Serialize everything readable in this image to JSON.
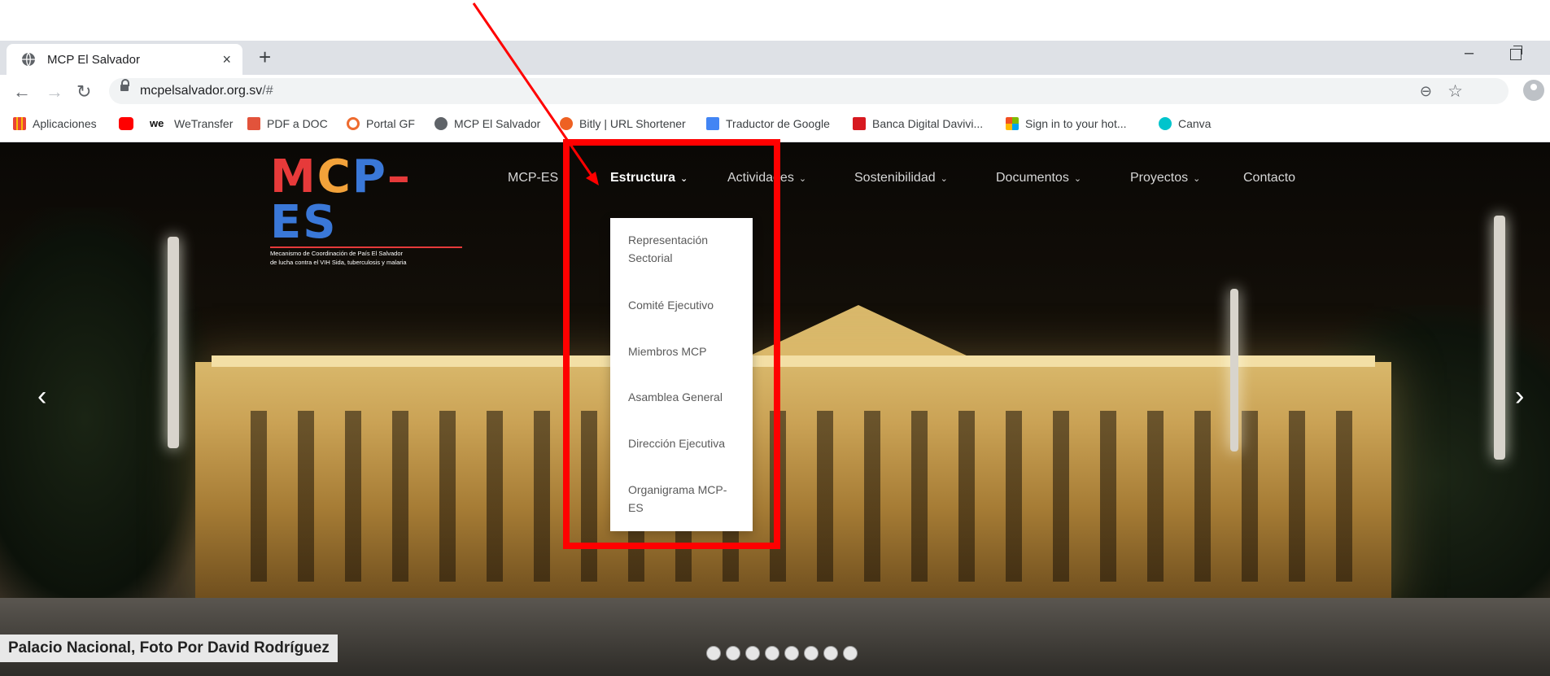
{
  "browser": {
    "tab_title": "MCP El Salvador",
    "new_tab": "+",
    "close": "×",
    "url_domain": "mcpelsalvador.org.sv",
    "url_path": "/#",
    "min": "–"
  },
  "bookmarks": [
    {
      "label": "Aplicaciones",
      "color": "#4285f4"
    },
    {
      "label": "",
      "color": "#ff0000"
    },
    {
      "label": "WeTransfer",
      "color": "#111111"
    },
    {
      "label": "PDF a DOC",
      "color": "#e2533b"
    },
    {
      "label": "Portal GF",
      "color": "#ee6b2f"
    },
    {
      "label": "MCP El Salvador",
      "color": "#5f6368"
    },
    {
      "label": "Bitly | URL Shortener",
      "color": "#ee6123"
    },
    {
      "label": "Traductor de Google",
      "color": "#4285f4"
    },
    {
      "label": "Banca Digital Davivi...",
      "color": "#d71920"
    },
    {
      "label": "Sign in to your hot...",
      "color": "#f25022"
    },
    {
      "label": "Canva",
      "color": "#00c4cc"
    }
  ],
  "site": {
    "logo": {
      "m": "M",
      "c": "C",
      "p": "P",
      "dash": "–",
      "es": "ES",
      "sub1": "Mecanismo de Coordinación de País El Salvador",
      "sub2": "de lucha contra el VIH Sida, tuberculosis y malaria"
    },
    "nav": [
      {
        "label": "MCP-ES",
        "chevron": "⌄"
      },
      {
        "label": "Estructura",
        "chevron": "⌄",
        "active": true
      },
      {
        "label": "Actividades",
        "chevron": "⌄"
      },
      {
        "label": "Sostenibilidad",
        "chevron": "⌄"
      },
      {
        "label": "Documentos",
        "chevron": "⌄"
      },
      {
        "label": "Proyectos",
        "chevron": "⌄"
      },
      {
        "label": "Contacto",
        "chevron": ""
      }
    ],
    "dropdown": [
      "Representación Sectorial",
      "Comité Ejecutivo",
      "Miembros MCP",
      "Asamblea General",
      "Dirección Ejecutiva",
      "Organigrama MCP-ES"
    ],
    "caption": "Palacio Nacional, Foto Por David Rodríguez",
    "slide_prev": "‹",
    "slide_next": "›",
    "slide_dots": 8
  },
  "annotation": {
    "color": "#ff0000"
  }
}
